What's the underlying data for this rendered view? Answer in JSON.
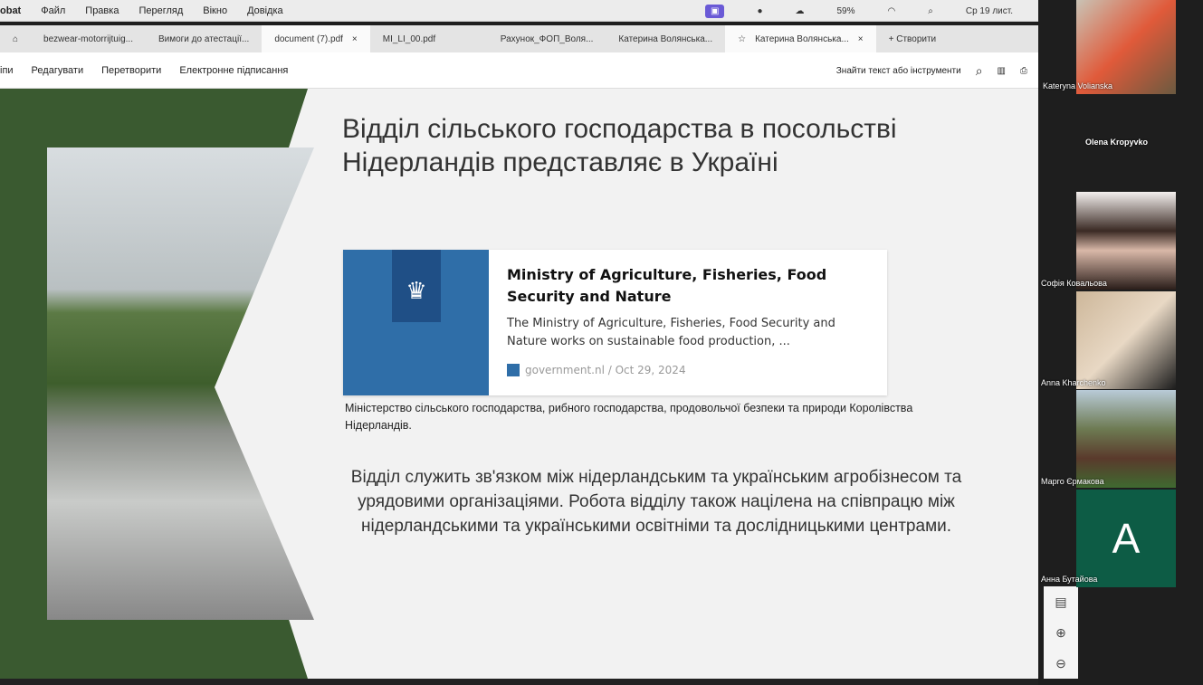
{
  "menubar": {
    "app": "obat",
    "items": [
      "Файл",
      "Правка",
      "Перегляд",
      "Вікно",
      "Довідка"
    ],
    "battery": "59%",
    "datetime": "Ср 19 лист."
  },
  "tabs": [
    {
      "label": "bezwear-motorrijtuig..."
    },
    {
      "label": "Вимоги до атестації..."
    },
    {
      "label": "document (7).pdf",
      "close": "×"
    },
    {
      "label": "MI_LI_00.pdf"
    },
    {
      "label": "Рахунок_ФОП_Воля..."
    },
    {
      "label": "Катерина Волянська..."
    },
    {
      "label": "Катерина Волянська...",
      "close": "×"
    }
  ],
  "new_tab": "+ Створити",
  "toolbar": {
    "items": [
      "іпи",
      "Редагувати",
      "Перетворити",
      "Електронне підписання"
    ],
    "search": "Знайти текст або інструменти"
  },
  "slide": {
    "title": "Відділ сільського господарства в посольстві Нідерландів представляє в Україні",
    "card": {
      "title": "Ministry of Agriculture, Fisheries, Food Security and Nature",
      "description": "The Ministry of Agriculture, Fisheries, Food Security and Nature works on sustainable food production, ...",
      "source": "government.nl / Oct  29,  2024"
    },
    "caption": "Міністерство сільського господарства, рибного господарства, продовольчої безпеки та природи  Королівства Нідерландів.",
    "body": "Відділ служить зв'язком між нідерландським та українським агробізнесом та урядовими організаціями. Робота відділу також націлена на співпрацю між нідерландськими та українськими освітніми та дослідницькими центрами."
  },
  "participants": [
    "Kateryna Volianska",
    "Olena Kropyvko",
    "Софія Ковальова",
    "Anna Kharchenko",
    "Марго Єрмакова",
    "Анна Бутайова"
  ],
  "avatar_letter": "A"
}
